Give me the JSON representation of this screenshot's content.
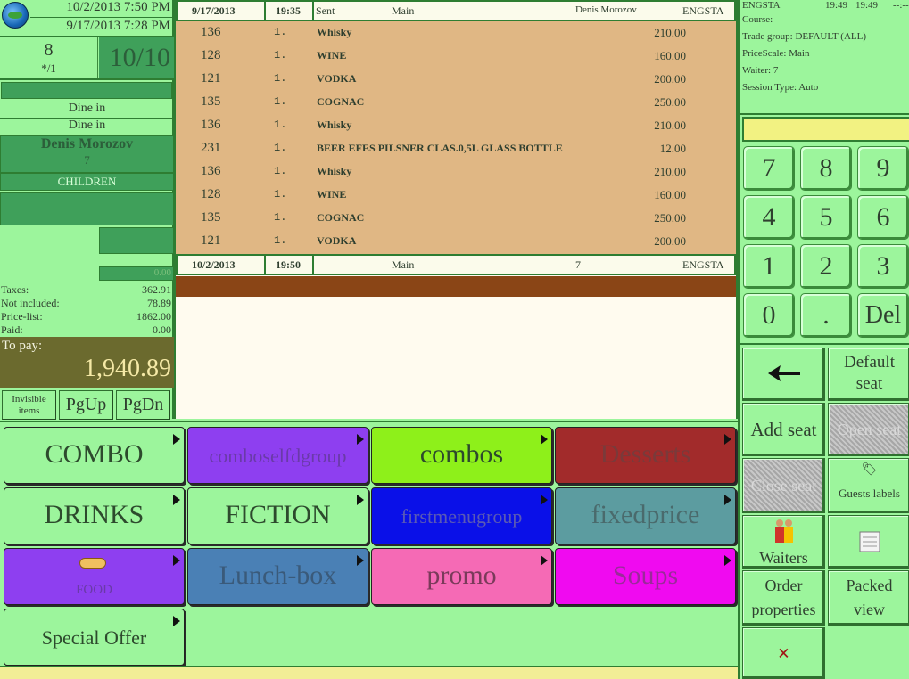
{
  "left": {
    "datetime_1": "10/2/2013 7:50 PM",
    "datetime_2": "9/17/2013 7:28 PM",
    "seat_number": "8",
    "seat_sub": "*/1",
    "guests": "10/10",
    "order_type_1": "Dine in",
    "order_type_2": "Dine in",
    "waiter_name": "Denis Morozov",
    "waiter_number": "7",
    "category": "CHILDREN",
    "small_value": "0.00",
    "summary": [
      {
        "label": "Taxes:",
        "value": "362.91"
      },
      {
        "label": "Not included:",
        "value": "78.89"
      },
      {
        "label": "Price-list:",
        "value": "1862.00"
      },
      {
        "label": "Paid:",
        "value": "0.00"
      }
    ],
    "to_pay_label": "To pay:",
    "to_pay_value": "1,940.89",
    "buttons": {
      "invisible": "Invisible items",
      "pgup": "PgUp",
      "pgdn": "PgDn"
    }
  },
  "order": {
    "header1": {
      "date": "9/17/2013",
      "time": "19:35",
      "status": "Sent",
      "course": "Main",
      "waiter": "Denis Morozov",
      "station": "ENGSTA"
    },
    "items": [
      {
        "code": "136",
        "qty": "1.",
        "name": "Whisky",
        "price": "210.00"
      },
      {
        "code": "128",
        "qty": "1.",
        "name": "WINE",
        "price": "160.00"
      },
      {
        "code": "121",
        "qty": "1.",
        "name": "VODKA",
        "price": "200.00"
      },
      {
        "code": "135",
        "qty": "1.",
        "name": "COGNAC",
        "price": "250.00"
      },
      {
        "code": "136",
        "qty": "1.",
        "name": "Whisky",
        "price": "210.00"
      },
      {
        "code": "231",
        "qty": "1.",
        "name": "BEER EFES PILSNER CLAS.0,5L GLASS BOTTLE",
        "price": "12.00"
      },
      {
        "code": "136",
        "qty": "1.",
        "name": "Whisky",
        "price": "210.00"
      },
      {
        "code": "128",
        "qty": "1.",
        "name": "WINE",
        "price": "160.00"
      },
      {
        "code": "135",
        "qty": "1.",
        "name": "COGNAC",
        "price": "250.00"
      },
      {
        "code": "121",
        "qty": "1.",
        "name": "VODKA",
        "price": "200.00"
      }
    ],
    "header2": {
      "date": "10/2/2013",
      "time": "19:50",
      "course": "Main",
      "waiter": "7",
      "station": "ENGSTA"
    }
  },
  "right": {
    "station": "ENGSTA",
    "time1": "19:49",
    "time2": "19:49",
    "dashes": "--:--",
    "course": "Course:",
    "trade_group": "Trade group: DEFAULT (ALL)",
    "price_scale": "PriceScale: Main",
    "waiter": "Waiter: 7",
    "session_type": "Session Type: Auto",
    "keypad": [
      "7",
      "8",
      "9",
      "4",
      "5",
      "6",
      "1",
      "2",
      "3",
      "0",
      ".",
      "Del"
    ],
    "buttons": {
      "back": "←",
      "default_seat": "Default seat",
      "add_seat": "Add seat",
      "open_seat": "Open seat",
      "close_seat": "Close seat",
      "guests_labels": "Guests labels",
      "waiters": "Waiters",
      "order_properties": "Order properties",
      "packed_view": "Packed view",
      "cancel": "×"
    }
  },
  "categories": [
    {
      "label": "COMBO",
      "color": "#9cf59c",
      "text_color": "#2d4a2d"
    },
    {
      "label": "comboselfdgroup",
      "color": "#8e3ff0",
      "text_color": "#6a3aa8"
    },
    {
      "label": "combos",
      "color": "#8ef01a",
      "text_color": "#2d4a2d"
    },
    {
      "label": "Desserts",
      "color": "#a22b2b",
      "text_color": "#7a3a3a"
    },
    {
      "label": "DRINKS",
      "color": "#9cf59c",
      "text_color": "#2d4a2d"
    },
    {
      "label": "FICTION",
      "color": "#9cf59c",
      "text_color": "#2d4a2d"
    },
    {
      "label": "firstmenugroup",
      "color": "#0a10e8",
      "text_color": "#5a5ab5"
    },
    {
      "label": "fixedprice",
      "color": "#5c9ca0",
      "text_color": "#4a6a6c"
    },
    {
      "label": "FOOD",
      "color": "#8e3ff0",
      "text_color": "#6a3aa8"
    },
    {
      "label": "Lunch-box",
      "color": "#4a80b5",
      "text_color": "#3a5a7a"
    },
    {
      "label": "promo",
      "color": "#f56ab5",
      "text_color": "#7a3a5a"
    },
    {
      "label": "Soups",
      "color": "#f00af0",
      "text_color": "#9a2a9a"
    },
    {
      "label": "Special Offer",
      "color": "#9cf59c",
      "text_color": "#2d4a2d"
    }
  ]
}
